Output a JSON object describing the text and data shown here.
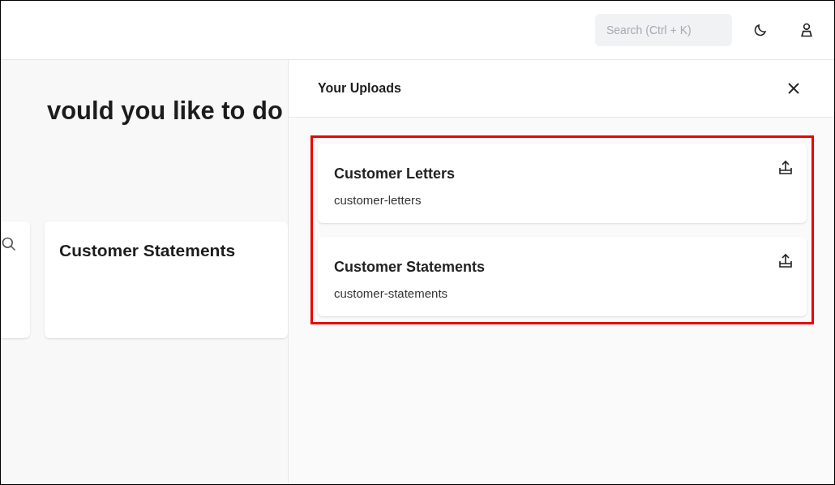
{
  "topbar": {
    "search": {
      "placeholder": "Search (Ctrl + K)"
    }
  },
  "page": {
    "heading": "vould you like to do",
    "cards": [
      {
        "title": "Customer Statements"
      }
    ]
  },
  "uploads_panel": {
    "title": "Your Uploads",
    "items": [
      {
        "title": "Customer Letters",
        "slug": "customer-letters"
      },
      {
        "title": "Customer Statements",
        "slug": "customer-statements"
      }
    ]
  }
}
